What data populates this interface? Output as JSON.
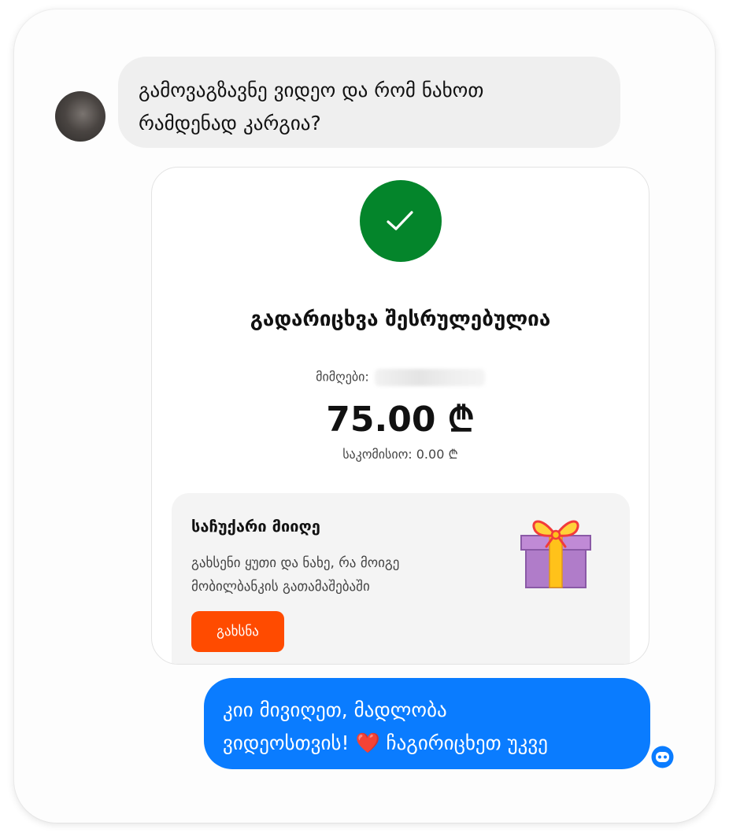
{
  "incoming_message": {
    "text_line1": "გამოვაგზავნე ვიდეო და რომ ნახოთ",
    "text_line2": "რამდენად კარგია?"
  },
  "transfer_card": {
    "status_icon": "check-icon",
    "status_title": "გადარიცხვა შესრულებულია",
    "recipient_label": "მიმღები:",
    "amount": "75.00 ₾",
    "commission": "საკომისიო: 0.00 ₾",
    "gift": {
      "title": "საჩუქარი მიიღე",
      "description_line1": "გახსენი ყუთი და ნახე, რა მოიგე",
      "description_line2": "მობილბანკის გათამაშებაში",
      "button_label": "გახსნა",
      "illustration": "gift-box-icon"
    }
  },
  "outgoing_message": {
    "text_line1": "კიი მივიღეთ, მადლობა",
    "text_line2_before_emoji": "ვიდეოსთვის!",
    "emoji": "❤️",
    "text_line2_after_emoji": "ჩაგირიცხეთ უკვე"
  },
  "colors": {
    "incoming_bubble": "#efefef",
    "outgoing_bubble": "#0a7cff",
    "success_green": "#04852b",
    "accent_orange": "#ff4b00",
    "gift_purple": "#b07cc9",
    "gift_ribbon": "#ffc21a"
  },
  "icons": {
    "avatar": "user-avatar",
    "status_badge": "messenger-bot-icon"
  }
}
